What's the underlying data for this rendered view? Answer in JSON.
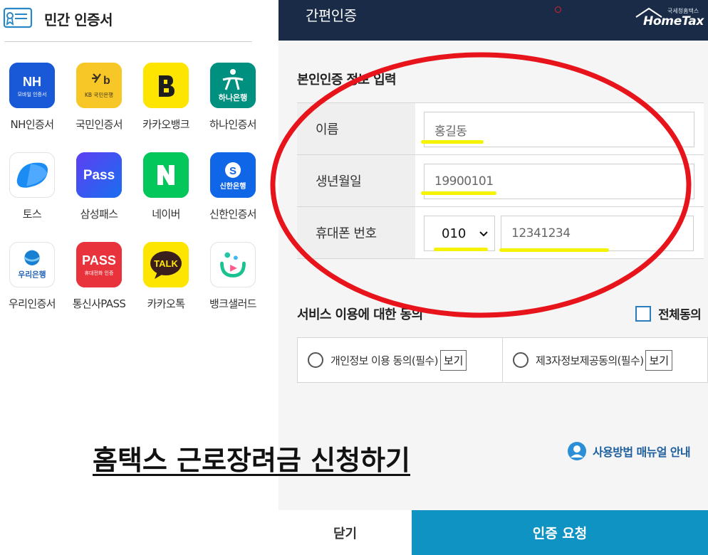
{
  "left_panel": {
    "title": "민간 인증서",
    "certificates": [
      {
        "label": "NH인증서",
        "icon": "nh-icon",
        "color": "#1b5fd8",
        "tile_text": "NH",
        "tile_sub": "모바일 인증서"
      },
      {
        "label": "국민인증서",
        "icon": "kb-icon",
        "color": "#f7c825",
        "tile_text": "★b",
        "tile_sub": "KB 국민은행"
      },
      {
        "label": "카카오뱅크",
        "icon": "kakaobank-icon",
        "color": "#fee500",
        "tile_text": "B"
      },
      {
        "label": "하나인증서",
        "icon": "hana-icon",
        "color": "#008c7a",
        "tile_text": "하나은행"
      },
      {
        "label": "토스",
        "icon": "toss-icon",
        "color": "#ffffff"
      },
      {
        "label": "삼성패스",
        "icon": "samsung-pass-icon",
        "color": "#3e57f2",
        "tile_text": "Pass"
      },
      {
        "label": "네이버",
        "icon": "naver-icon",
        "color": "#03c75a",
        "tile_text": "N"
      },
      {
        "label": "신한인증서",
        "icon": "shinhan-icon",
        "color": "#1168e8",
        "tile_text": "신한은행"
      },
      {
        "label": "우리인증서",
        "icon": "woori-icon",
        "color": "#ffffff",
        "tile_text": "우리은행"
      },
      {
        "label": "통신사PASS",
        "icon": "pass-icon",
        "color": "#e8343c",
        "tile_text": "PASS",
        "tile_sub": "휴대전화 인증"
      },
      {
        "label": "카카오톡",
        "icon": "kakaotalk-icon",
        "color": "#fee500",
        "tile_text": "TALK"
      },
      {
        "label": "뱅크샐러드",
        "icon": "banksalad-icon",
        "color": "#ffffff"
      }
    ]
  },
  "right_panel": {
    "header_title": "간편인증",
    "logo_small": "국세청홈택스",
    "logo_big": "HomeTax",
    "section_title": "본인인증 정보 입력",
    "form": {
      "name_label": "이름",
      "name_value": "홍길동",
      "birth_label": "생년월일",
      "birth_value": "19900101",
      "phone_label": "휴대폰 번호",
      "phone_prefix": "010",
      "phone_value": "12341234"
    },
    "consent": {
      "title": "서비스 이용에 대한 동의",
      "all_agree": "전체동의",
      "item1": "개인정보 이용 동의(필수)",
      "item2": "제3자정보제공동의(필수)",
      "view_label": "보기"
    },
    "manual_link": "사용방법 매뉴얼 안내",
    "close_button": "닫기",
    "request_button": "인증 요청"
  },
  "overlay": {
    "caption": "홈택스 근로장려금 신청하기",
    "annotation_color": "#e8141b",
    "highlight_color": "#f7f300"
  }
}
